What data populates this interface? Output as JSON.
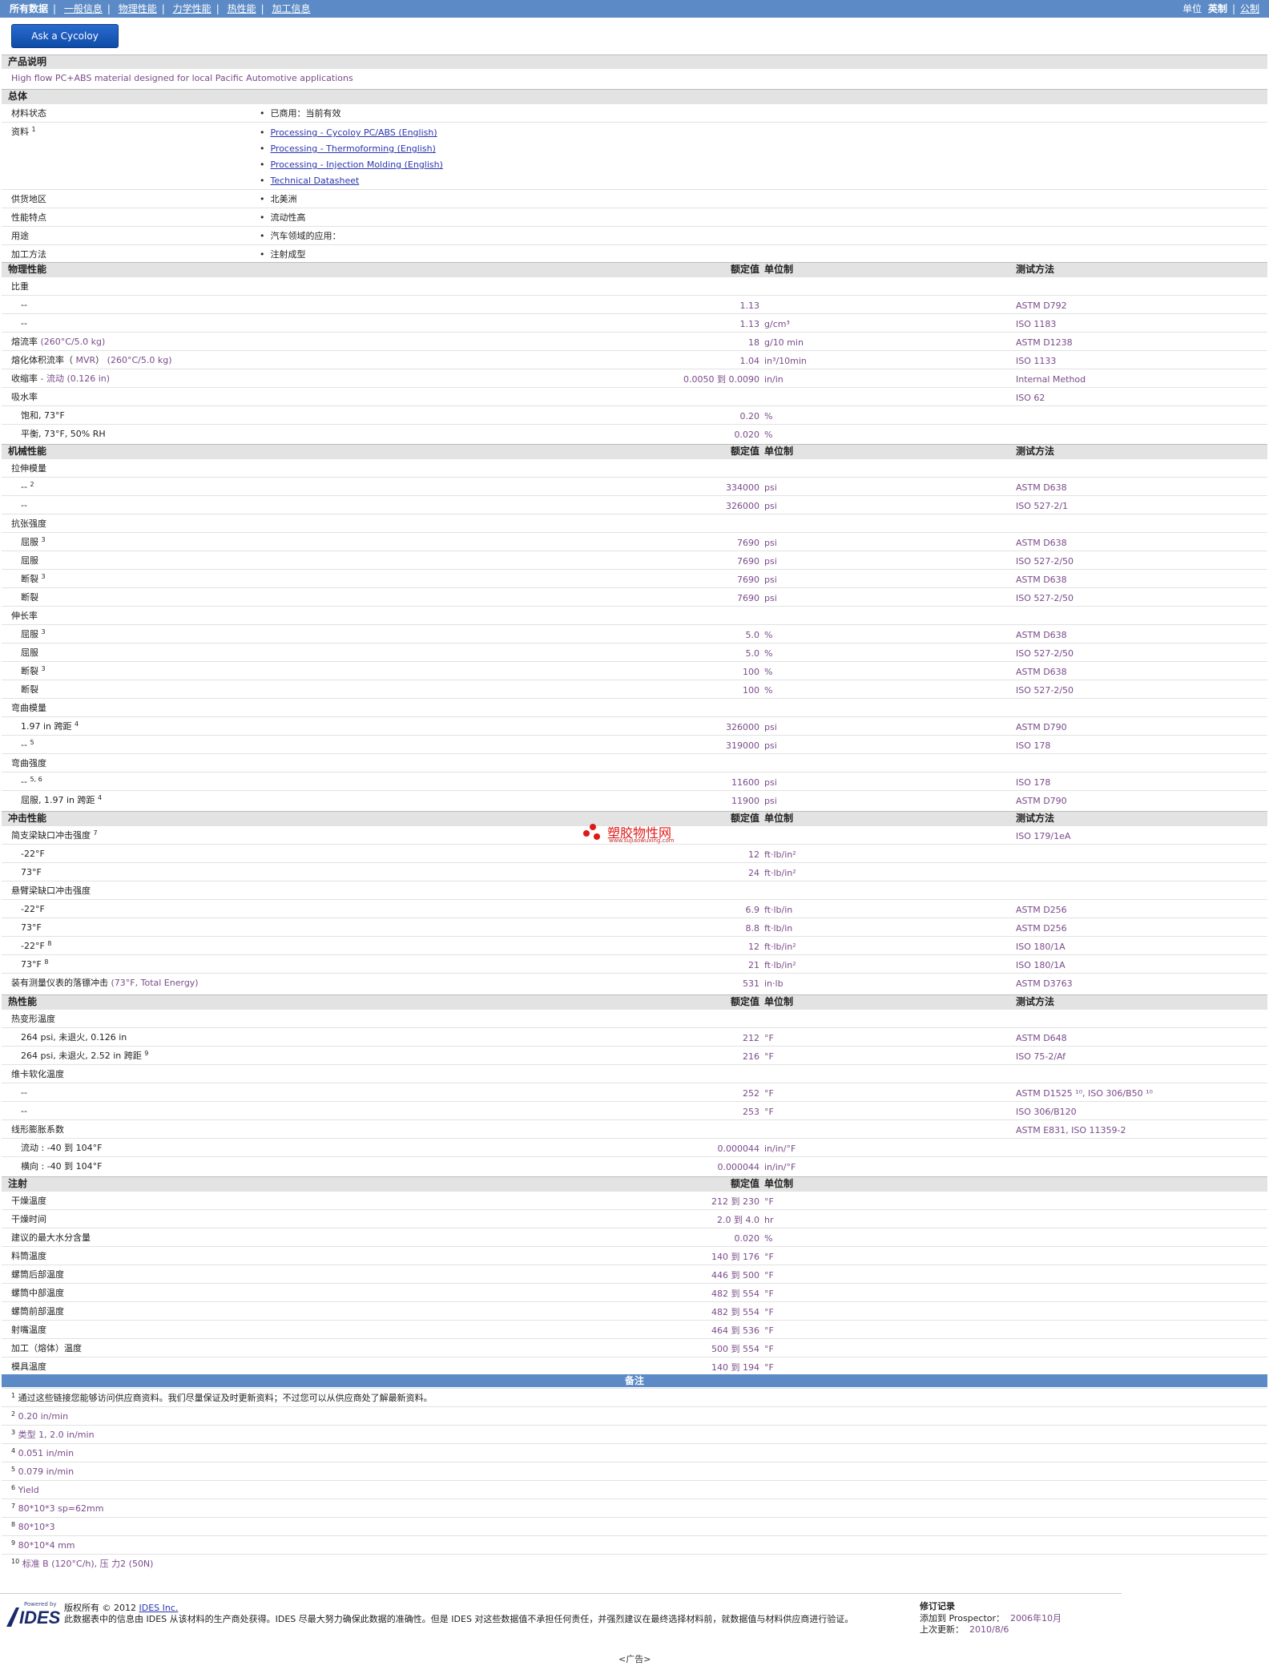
{
  "topbar": {
    "nav": [
      {
        "label": "所有数据",
        "current": true
      },
      {
        "label": "一般信息"
      },
      {
        "label": "物理性能"
      },
      {
        "label": "力学性能"
      },
      {
        "label": "热性能"
      },
      {
        "label": "加工信息"
      }
    ],
    "units_label": "单位",
    "unit_current": "英制",
    "unit_other": "公制"
  },
  "ask_button": "Ask a Cycoloy Engineer",
  "col_headers": {
    "value": "额定值",
    "unit": "单位制",
    "method": "测试方法"
  },
  "product_desc": {
    "title": "产品说明",
    "text": "High flow PC+ABS material designed for local Pacific Automotive applications"
  },
  "general": {
    "title": "总体",
    "status_label": "材料状态",
    "status_value": "已商用：当前有效",
    "docs_label": "资料",
    "docs_sup": "1",
    "docs": [
      "Processing - Cycoloy PC/ABS (English)",
      "Processing - Thermoforming (English)",
      "Processing - Injection Molding (English)",
      "Technical Datasheet"
    ],
    "region_label": "供货地区",
    "region_value": "北美洲",
    "features_label": "性能特点",
    "features_value": "流动性高",
    "uses_label": "用途",
    "uses_value": "汽车领域的应用：",
    "method_label": "加工方法",
    "method_value": "注射成型"
  },
  "physical": {
    "title": "物理性能",
    "rows": [
      {
        "label": "比重",
        "indent": false
      },
      {
        "label": "--",
        "indent": true,
        "value": "1.13",
        "unit": "",
        "method": "ASTM D792"
      },
      {
        "label": "--",
        "indent": true,
        "value": "1.13",
        "unit": "g/cm³",
        "method": "ISO 1183"
      },
      {
        "label": "熔流率",
        "cond": "(260°C/5.0 kg)",
        "value": "18",
        "unit": "g/10 min",
        "method": "ASTM D1238"
      },
      {
        "label": "熔化体积流率（",
        "cond": "MVR",
        "label2": "）",
        "cond2": "(260°C/5.0 kg)",
        "value": "1.04",
        "unit": "in³/10min",
        "method": "ISO 1133"
      },
      {
        "label": "收缩率",
        "cond": "- 流动 (0.126 in)",
        "value": "0.0050 到 0.0090",
        "unit": "in/in",
        "method": "Internal Method"
      },
      {
        "label": "吸水率",
        "method": "ISO 62"
      },
      {
        "label": "饱和, 73°F",
        "indent": true,
        "value": "0.20",
        "unit": "%"
      },
      {
        "label": "平衡, 73°F, 50% RH",
        "indent": true,
        "value": "0.020",
        "unit": "%"
      }
    ]
  },
  "mechanical": {
    "title": "机械性能",
    "rows": [
      {
        "label": "拉伸模量"
      },
      {
        "label": "--",
        "sup": "2",
        "indent": true,
        "value": "334000",
        "unit": "psi",
        "method": "ASTM D638"
      },
      {
        "label": "--",
        "indent": true,
        "value": "326000",
        "unit": "psi",
        "method": "ISO 527-2/1"
      },
      {
        "label": "抗张强度"
      },
      {
        "label": "屈服",
        "sup": "3",
        "indent": true,
        "value": "7690",
        "unit": "psi",
        "method": "ASTM D638"
      },
      {
        "label": "屈服",
        "indent": true,
        "value": "7690",
        "unit": "psi",
        "method": "ISO 527-2/50"
      },
      {
        "label": "断裂",
        "sup": "3",
        "indent": true,
        "value": "7690",
        "unit": "psi",
        "method": "ASTM D638"
      },
      {
        "label": "断裂",
        "indent": true,
        "value": "7690",
        "unit": "psi",
        "method": "ISO 527-2/50"
      },
      {
        "label": "伸长率"
      },
      {
        "label": "屈服",
        "sup": "3",
        "indent": true,
        "value": "5.0",
        "unit": "%",
        "method": "ASTM D638"
      },
      {
        "label": "屈服",
        "indent": true,
        "value": "5.0",
        "unit": "%",
        "method": "ISO 527-2/50"
      },
      {
        "label": "断裂",
        "sup": "3",
        "indent": true,
        "value": "100",
        "unit": "%",
        "method": "ASTM D638"
      },
      {
        "label": "断裂",
        "indent": true,
        "value": "100",
        "unit": "%",
        "method": "ISO 527-2/50"
      },
      {
        "label": "弯曲模量"
      },
      {
        "label": "1.97 in 跨距",
        "sup": "4",
        "indent": true,
        "value": "326000",
        "unit": "psi",
        "method": "ASTM D790"
      },
      {
        "label": "--",
        "sup": "5",
        "indent": true,
        "value": "319000",
        "unit": "psi",
        "method": "ISO 178"
      },
      {
        "label": "弯曲强度"
      },
      {
        "label": "--",
        "sup": "5, 6",
        "indent": true,
        "value": "11600",
        "unit": "psi",
        "method": "ISO 178"
      },
      {
        "label": "屈服, 1.97 in 跨距",
        "sup": "4",
        "indent": true,
        "value": "11900",
        "unit": "psi",
        "method": "ASTM D790"
      }
    ]
  },
  "impact": {
    "title": "冲击性能",
    "rows": [
      {
        "label": "简支梁缺口冲击强度",
        "sup": "7",
        "method": "ISO 179/1eA"
      },
      {
        "label": "-22°F",
        "indent": true,
        "value": "12",
        "unit": "ft·lb/in²"
      },
      {
        "label": "73°F",
        "indent": true,
        "value": "24",
        "unit": "ft·lb/in²"
      },
      {
        "label": "悬臂梁缺口冲击强度"
      },
      {
        "label": "-22°F",
        "indent": true,
        "value": "6.9",
        "unit": "ft·lb/in",
        "method": "ASTM D256"
      },
      {
        "label": "73°F",
        "indent": true,
        "value": "8.8",
        "unit": "ft·lb/in",
        "method": "ASTM D256"
      },
      {
        "label": "-22°F",
        "sup": "8",
        "indent": true,
        "value": "12",
        "unit": "ft·lb/in²",
        "method": "ISO 180/1A"
      },
      {
        "label": "73°F",
        "sup": "8",
        "indent": true,
        "value": "21",
        "unit": "ft·lb/in²",
        "method": "ISO 180/1A"
      },
      {
        "label": "装有测量仪表的落镖冲击",
        "cond": "(73°F, Total Energy)",
        "value": "531",
        "unit": "in·lb",
        "method": "ASTM D3763"
      }
    ]
  },
  "thermal": {
    "title": "热性能",
    "rows": [
      {
        "label": "热变形温度"
      },
      {
        "label": "264 psi, 未退火, 0.126 in",
        "indent": true,
        "value": "212",
        "unit": "°F",
        "method": "ASTM D648"
      },
      {
        "label": "264 psi, 未退火, 2.52 in 跨距",
        "sup": "9",
        "indent": true,
        "value": "216",
        "unit": "°F",
        "method": "ISO 75-2/Af"
      },
      {
        "label": "维卡软化温度"
      },
      {
        "label": "--",
        "indent": true,
        "value": "252",
        "unit": "°F",
        "method": "ASTM D1525 ¹⁰, ISO 306/B50 ¹⁰"
      },
      {
        "label": "--",
        "indent": true,
        "value": "253",
        "unit": "°F",
        "method": "ISO 306/B120"
      },
      {
        "label": "线形膨胀系数",
        "method": "ASTM E831, ISO 11359-2"
      },
      {
        "label": "流动 : -40 到 104°F",
        "indent": true,
        "value": "0.000044",
        "unit": "in/in/°F"
      },
      {
        "label": "横向 : -40 到 104°F",
        "indent": true,
        "value": "0.000044",
        "unit": "in/in/°F"
      }
    ]
  },
  "injection": {
    "title": "注射",
    "rows": [
      {
        "label": "干燥温度",
        "value": "212 到 230",
        "unit": "°F"
      },
      {
        "label": "干燥时间",
        "value": "2.0 到 4.0",
        "unit": "hr"
      },
      {
        "label": "建议的最大水分含量",
        "value": "0.020",
        "unit": "%"
      },
      {
        "label": "料筒温度",
        "value": "140 到 176",
        "unit": "°F"
      },
      {
        "label": "螺筒后部温度",
        "value": "446 到 500",
        "unit": "°F"
      },
      {
        "label": "螺筒中部温度",
        "value": "482 到 554",
        "unit": "°F"
      },
      {
        "label": "螺筒前部温度",
        "value": "482 到 554",
        "unit": "°F"
      },
      {
        "label": "射嘴温度",
        "value": "464 到 536",
        "unit": "°F"
      },
      {
        "label": "加工（熔体）温度",
        "value": "500 到 554",
        "unit": "°F"
      },
      {
        "label": "模具温度",
        "value": "140 到 194",
        "unit": "°F"
      }
    ]
  },
  "notes": {
    "title": "备注",
    "items": [
      {
        "n": "1",
        "text": "通过这些链接您能够访问供应商资料。我们尽量保证及时更新资料；不过您可以从供应商处了解最新资料。",
        "cn": true
      },
      {
        "n": "2",
        "text": "0.20 in/min"
      },
      {
        "n": "3",
        "text": "类型  1, 2.0 in/min"
      },
      {
        "n": "4",
        "text": "0.051 in/min"
      },
      {
        "n": "5",
        "text": "0.079 in/min"
      },
      {
        "n": "6",
        "text": "Yield"
      },
      {
        "n": "7",
        "text": "80*10*3 sp=62mm"
      },
      {
        "n": "8",
        "text": "80*10*3"
      },
      {
        "n": "9",
        "text": "80*10*4 mm"
      },
      {
        "n": "10",
        "text": "标准  B (120°C/h), 压 力2 (50N)"
      }
    ]
  },
  "footer": {
    "logo_small": "Powered by",
    "logo_big": "IDES",
    "copyright": "版权所有 © 2012",
    "company": "IDES Inc.",
    "disclaimer": "此数据表中的信息由 IDES 从该材料的生产商处获得。IDES 尽最大努力确保此数据的准确性。但是 IDES 对这些数据值不承担任何责任，并强烈建议在最终选择材料前，就数据值与材料供应商进行验证。",
    "rev_title": "修订记录",
    "added_label": "添加到 Prospector：",
    "added_value": "2006年10月",
    "updated_label": "上次更新：",
    "updated_value": "2010/8/6"
  },
  "watermark": {
    "cn": "塑胶物性网",
    "en": "www.sujiaowuxing.com"
  },
  "ad": "<广告>"
}
